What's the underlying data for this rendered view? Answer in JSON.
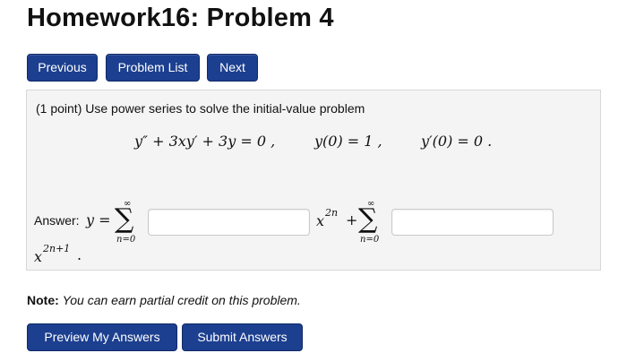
{
  "page": {
    "title": "Homework16: Problem 4"
  },
  "nav": {
    "previous": "Previous",
    "problem_list": "Problem List",
    "next": "Next"
  },
  "problem": {
    "prompt": "(1 point) Use power series to solve the initial-value problem",
    "equation": "y″ + 3xy′ + 3y = 0 ,",
    "condition_y0": "y(0) = 1 ,",
    "condition_yp0": "y′(0) = 0 .",
    "answer_label": "Answer:",
    "answer_lhs": "y =",
    "sum_upper": "∞",
    "sum_lower": "n=0",
    "term1_var": "x",
    "term1_exp": "2n",
    "plus": "+",
    "term2_var": "x",
    "term2_exp": "2n+1",
    "period": ".",
    "answer1_value": "",
    "answer2_value": ""
  },
  "note": {
    "label": "Note:",
    "text": "You can earn partial credit on this problem."
  },
  "actions": {
    "preview": "Preview My Answers",
    "submit": "Submit Answers"
  }
}
